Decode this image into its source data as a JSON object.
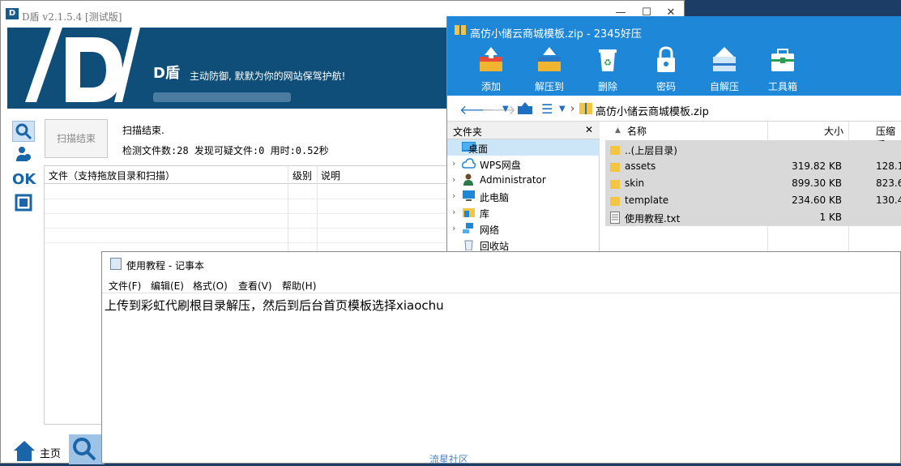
{
  "dshield": {
    "title": "D盾 v2.1.5.4 [测试版]",
    "brand": "D盾",
    "slogan": "主动防御, 默默为你的网站保驾护航!",
    "scan_button": "扫描结束",
    "status": "扫描结束.",
    "stats": "检测文件数:28 发现可疑文件:0 用时:0.52秒",
    "table_headers": [
      "文件（支持拖放目录和扫描）",
      "级别",
      "说明"
    ],
    "side_ok": "OK",
    "bottom_home": "主页"
  },
  "zip": {
    "title": "高仿小储云商城模板.zip - 2345好压",
    "tools": [
      "添加",
      "解压到",
      "删除",
      "密码",
      "自解压",
      "工具箱"
    ],
    "path": "高仿小储云商城模板.zip",
    "tree_header": "文件夹",
    "tree_items": [
      "桌面",
      "WPS网盘",
      "Administrator",
      "此电脑",
      "库",
      "网络",
      "回收站"
    ],
    "list_headers": {
      "name": "名称",
      "size": "大小",
      "compressed": "压缩后"
    },
    "files": [
      {
        "name": "..(上层目录)",
        "size": "",
        "compressed": ""
      },
      {
        "name": "assets",
        "size": "319.82 KB",
        "compressed": "128.1"
      },
      {
        "name": "skin",
        "size": "899.30 KB",
        "compressed": "823.6"
      },
      {
        "name": "template",
        "size": "234.60 KB",
        "compressed": "130.4"
      },
      {
        "name": "使用教程.txt",
        "size": "1 KB",
        "compressed": ""
      }
    ]
  },
  "notepad": {
    "title": "使用教程 - 记事本",
    "menu": [
      "文件(F)",
      "编辑(E)",
      "格式(O)",
      "查看(V)",
      "帮助(H)"
    ],
    "content": "上传到彩虹代刷根目录解压，然后到后台首页模板选择xiaochu"
  },
  "watermark": "流星社区"
}
